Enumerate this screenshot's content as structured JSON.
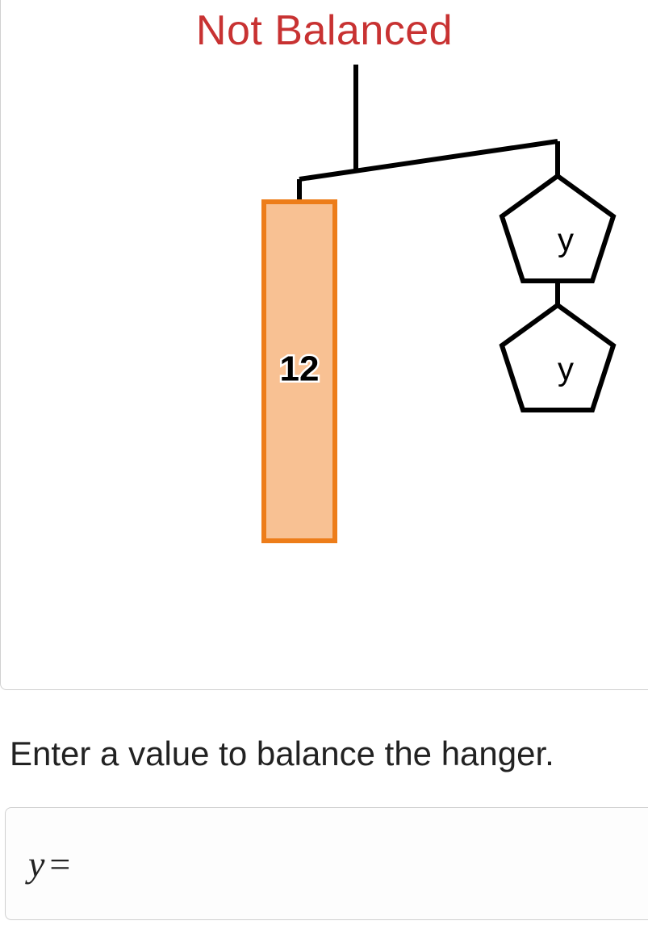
{
  "status": "Not Balanced",
  "hanger": {
    "leftBlock": {
      "value": "12"
    },
    "rightPentagons": [
      {
        "label": "y"
      },
      {
        "label": "y"
      }
    ]
  },
  "prompt": "Enter a value to balance the hanger.",
  "input": {
    "variable": "y",
    "equals": "=",
    "value": ""
  }
}
